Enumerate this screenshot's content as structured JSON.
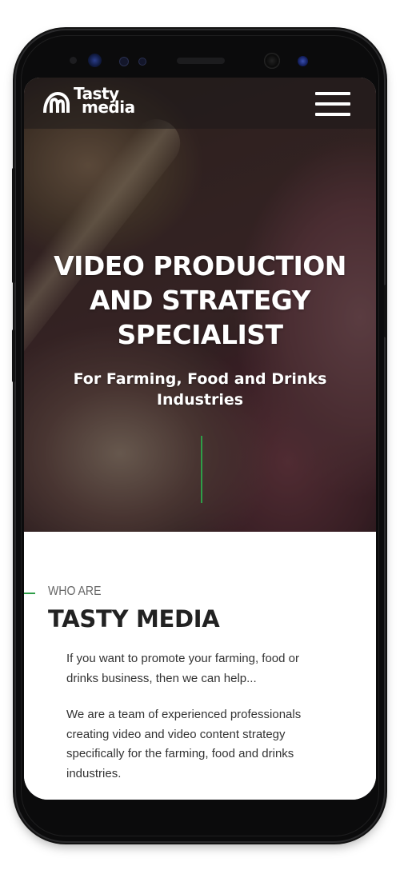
{
  "device": {
    "frame_color": "#0b0b0c"
  },
  "header": {
    "logo_line1": "Tasty",
    "logo_line2": "media",
    "menu_icon": "hamburger-menu-icon"
  },
  "hero": {
    "title_line1": "VIDEO PRODUCTION",
    "title_line2": "AND STRATEGY",
    "title_line3": "SPECIALIST",
    "subtitle_line1": "For Farming, Food and Drinks",
    "subtitle_line2": "Industries"
  },
  "about": {
    "eyebrow": "WHO ARE",
    "title": "TASTY MEDIA",
    "paragraph1_lines": [
      "If you want to promote your farming, food or",
      "drinks business, then we can help..."
    ],
    "paragraph2_lines": [
      "We are a team of experienced professionals",
      "creating video and video content strategy",
      "specifically for the farming, food and drinks",
      "industries."
    ]
  },
  "colors": {
    "accent": "#2e9e48",
    "text_dark": "#222222",
    "text_muted": "#666666"
  }
}
